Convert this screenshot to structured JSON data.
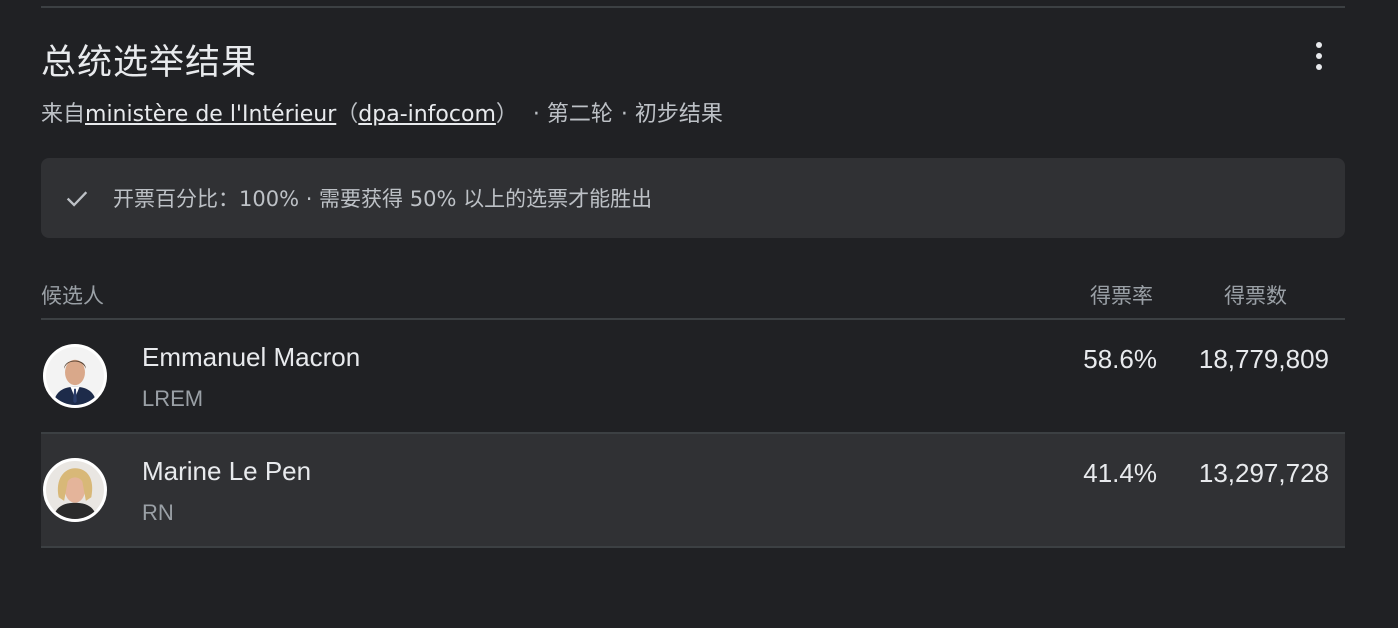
{
  "header": {
    "title": "总统选举结果",
    "more_icon": "more-vert-icon"
  },
  "source": {
    "prefix": "来自",
    "link1": "ministère de l'Intérieur",
    "paren_open": "（",
    "link2": "dpa-infocom",
    "paren_close": "）",
    "round": "· 第二轮",
    "status": "· 初步结果"
  },
  "notice": {
    "icon": "check-icon",
    "text": "开票百分比：100% · 需要获得 50% 以上的选票才能胜出"
  },
  "table": {
    "headers": {
      "candidate": "候选人",
      "rate": "得票率",
      "votes": "得票数"
    },
    "rows": [
      {
        "name": "Emmanuel Macron",
        "party": "LREM",
        "rate": "58.6%",
        "votes": "18,779,809",
        "avatar": "candidate-photo"
      },
      {
        "name": "Marine Le Pen",
        "party": "RN",
        "rate": "41.4%",
        "votes": "13,297,728",
        "avatar": "candidate-photo"
      }
    ]
  },
  "colors": {
    "background": "#202124",
    "panel": "#303134",
    "divider": "#3c4043",
    "text_primary": "#e8eaed",
    "text_secondary": "#9aa0a6"
  }
}
